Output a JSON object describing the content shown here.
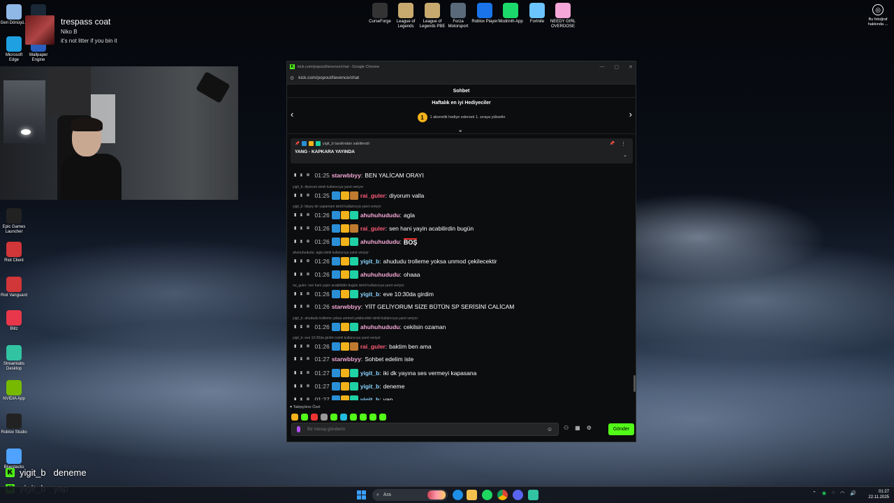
{
  "desktop": {
    "left_icons": [
      {
        "label": "Geri Dönüşü...",
        "icon": "recycle-bin-icon",
        "color": "#8fb8e6"
      },
      {
        "label": "Steam",
        "icon": "steam-icon",
        "color": "#1b2838"
      },
      {
        "label": "Microsoft Edge",
        "icon": "edge-icon",
        "color": "#1fa0e0"
      },
      {
        "label": "Wallpaper Engine",
        "icon": "wallpaper-engine-icon",
        "color": "#2a5fbf"
      },
      {
        "label": "Epic Games Launcher",
        "icon": "epic-games-icon",
        "color": "#222222"
      },
      {
        "label": "Riot Client",
        "icon": "riot-client-icon",
        "color": "#d13639"
      },
      {
        "label": "Riot Vanguard",
        "icon": "riot-vanguard-icon",
        "color": "#d13639"
      },
      {
        "label": "Blitz",
        "icon": "blitz-icon",
        "color": "#e8374a"
      },
      {
        "label": "Streamlabs Desktop",
        "icon": "streamlabs-icon",
        "color": "#31c3a2"
      },
      {
        "label": "NVIDIA App",
        "icon": "nvidia-icon",
        "color": "#76b900"
      },
      {
        "label": "Roblox Studio",
        "icon": "roblox-studio-icon",
        "color": "#222222"
      },
      {
        "label": "Bluestacks",
        "icon": "bluestacks-icon",
        "color": "#4fa3ff"
      }
    ],
    "top_icons": [
      {
        "label": "CurseForge",
        "icon": "curseforge-icon",
        "color": "#333333"
      },
      {
        "label": "League of Legends",
        "icon": "league-icon",
        "color": "#c8aa6e"
      },
      {
        "label": "League of Legends PBE",
        "icon": "league-pbe-icon",
        "color": "#c8aa6e"
      },
      {
        "label": "Forza Motorsport",
        "icon": "forza-icon",
        "color": "#5a6a7a"
      },
      {
        "label": "Roblox Player",
        "icon": "roblox-icon",
        "color": "#1a73e8"
      },
      {
        "label": "Modrinth App",
        "icon": "modrinth-icon",
        "color": "#1bd96a"
      },
      {
        "label": "Fortnite",
        "icon": "fortnite-icon",
        "color": "#6bc4ff"
      },
      {
        "label": "NEEDY GIRL OVERDOSE",
        "icon": "needy-girl-icon",
        "color": "#f4a7d8"
      }
    ],
    "photo_info": "Bu fotoğraf hakkında ..."
  },
  "now_playing": {
    "title": "trespass coat",
    "artist": "Niko B",
    "line": "it's not litter if you bin it"
  },
  "browser": {
    "title": "kick.com/popout/lievence/chat - Google Chrome",
    "url": "kick.com/popout/lievence/chat",
    "controls": [
      "—",
      "▢",
      "✕"
    ]
  },
  "chat": {
    "header": "Sohbet",
    "gifters_title": "Haftalık en iyi Hediyeciler",
    "gifters_badge": "1",
    "gifters_sub": "1 abonelik hediye edersek 1. sıraya yükselin",
    "pinned": {
      "by": "yigit_b tarafından sabitlendi",
      "text": "YANG - KAPKARA YAYINDA"
    },
    "messages": [
      {
        "time": "01:25",
        "user": "starwbbyy",
        "color": "#f2a7d6",
        "badges": [],
        "text": "BEN YALİCAM ORAYI",
        "reply": ""
      },
      {
        "time": "01:25",
        "user": "rai_guler",
        "color": "#ff5c7a",
        "badges": [
          "blue",
          "gold",
          "pick"
        ],
        "text": "diyorum valla",
        "reply": "yigit_b: diyorum isimli kullanıcıya yanıt veriyor"
      },
      {
        "time": "01:26",
        "user": "ahuhuhududu",
        "color": "#f2a7d6",
        "badges": [
          "blue",
          "gold",
          "teal"
        ],
        "text": "agla",
        "reply": "yigit_b: biişey de yapamam isimli kullanıcıya yanıt veriyor"
      },
      {
        "time": "01:26",
        "user": "rai_guler",
        "color": "#ff5c7a",
        "badges": [
          "blue",
          "gold",
          "pick"
        ],
        "text": "sen hani yayin acabilirdin bugün",
        "reply": ""
      },
      {
        "time": "01:26",
        "user": "ahuhuhududu",
        "color": "#f2a7d6",
        "badges": [
          "blue",
          "gold",
          "teal"
        ],
        "text": "BOŞ",
        "reply": ""
      },
      {
        "time": "01:26",
        "user": "yigit_b",
        "color": "#8ad4ff",
        "badges": [
          "blue",
          "gold",
          "teal"
        ],
        "text": "ahududu trolleme yoksa unmod çekilecektir",
        "reply": "ahuhuhududu: agla isimli kullanıcıya yanıt veriyor"
      },
      {
        "time": "01:26",
        "user": "ahuhuhududu",
        "color": "#f2a7d6",
        "badges": [
          "blue",
          "gold",
          "teal"
        ],
        "text": "ohaaa",
        "reply": ""
      },
      {
        "time": "01:26",
        "user": "yigit_b",
        "color": "#8ad4ff",
        "badges": [
          "blue",
          "gold",
          "teal"
        ],
        "text": "eve 10:30da girdim",
        "reply": "rai_guler: sen hani yayin acabilirdin bugün isimli kullanıcıya yanıt veriyor"
      },
      {
        "time": "01:26",
        "user": "starwbbyy",
        "color": "#f2a7d6",
        "badges": [],
        "text": "YİİT GELİYORUM SİZE BÜTÜN SP SERİSİNİ CALİCAM",
        "reply": ""
      },
      {
        "time": "01:26",
        "user": "ahuhuhududu",
        "color": "#f2a7d6",
        "badges": [
          "blue",
          "gold",
          "teal"
        ],
        "text": "cekilsin ozaman",
        "reply": "yigit_b: ahududu trolleme yoksa unmod çekilecektir isimli kullanıcıya yanıt veriyor"
      },
      {
        "time": "01:26",
        "user": "rai_guler",
        "color": "#ff5c7a",
        "badges": [
          "blue",
          "gold",
          "pick"
        ],
        "text": "baktim ben ama",
        "reply": "yigit_b: eve 10:30da girdim isimli kullanıcıya yanıt veriyor"
      },
      {
        "time": "01:27",
        "user": "starwbbyy",
        "color": "#f2a7d6",
        "badges": [],
        "text": "Sohbet edelim iste",
        "reply": ""
      },
      {
        "time": "01:27",
        "user": "yigit_b",
        "color": "#8ad4ff",
        "badges": [
          "blue",
          "gold",
          "teal"
        ],
        "text": "iki dk yayına ses vermeyi kapasana",
        "reply": ""
      },
      {
        "time": "01:27",
        "user": "yigit_b",
        "color": "#8ad4ff",
        "badges": [
          "blue",
          "gold",
          "teal"
        ],
        "text": "deneme",
        "reply": ""
      },
      {
        "time": "01:27",
        "user": "yigit_b",
        "color": "#8ad4ff",
        "badges": [
          "blue",
          "gold",
          "teal"
        ],
        "text": "yap",
        "reply": ""
      }
    ],
    "follower_label": "♥ Takipçilere Özel",
    "input_placeholder": "Bir mesaj gönderin",
    "send_label": "Gönder",
    "accent": "#53fc18"
  },
  "overlay": [
    {
      "user": "yigit_b",
      "text": "deneme"
    },
    {
      "user": "yigit_b",
      "text": "yap"
    }
  ],
  "taskbar": {
    "search_label": "Ara",
    "time": "01:27",
    "date": "22.11.2025"
  }
}
